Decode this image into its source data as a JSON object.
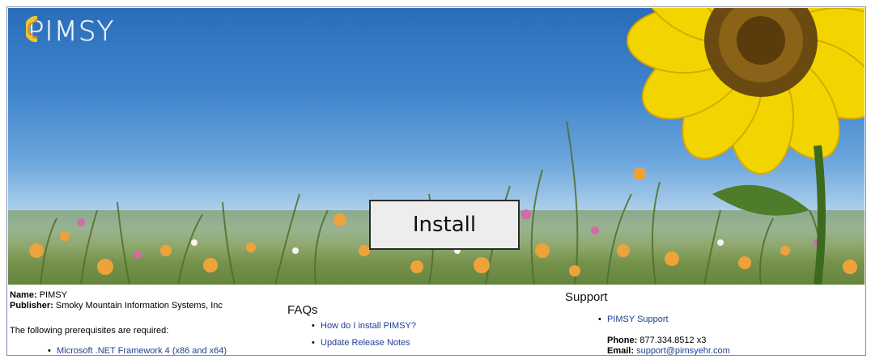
{
  "brand": {
    "logo_text": "PIMSY"
  },
  "hero": {
    "install_label": "Install"
  },
  "app_info": {
    "name_label": "Name:",
    "name_value": "PIMSY",
    "publisher_label": "Publisher:",
    "publisher_value": "Smoky Mountain Information Systems, Inc",
    "prereq_text": "The following prerequisites are required:",
    "prerequisites": [
      "Microsoft .NET Framework 4 (x86 and x64)"
    ]
  },
  "faqs": {
    "title": "FAQs",
    "links": [
      "How do I install PIMSY?",
      "Update Release Notes"
    ]
  },
  "support": {
    "title": "Support",
    "link": "PIMSY Support",
    "phone_label": "Phone:",
    "phone_value": "877.334.8512 x3",
    "email_label": "Email:",
    "email_value": "support@pimsyehr.com"
  },
  "colors": {
    "link": "#1f3f8f",
    "sky": "#3f84cc",
    "sunflower": "#f2d500",
    "button_bg": "#ededed"
  }
}
